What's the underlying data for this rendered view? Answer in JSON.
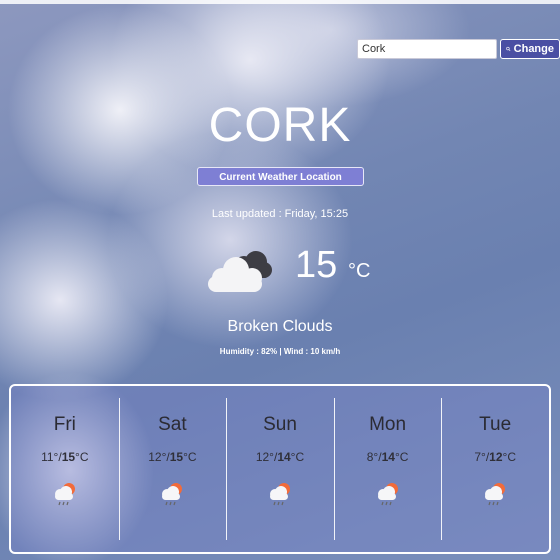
{
  "search": {
    "value": "Cork",
    "button_label": "Change"
  },
  "city": "CORK",
  "location_button": "Current Weather Location",
  "last_updated": "Last updated : Friday, 15:25",
  "current": {
    "temperature": "15",
    "unit": "°C",
    "description": "Broken Clouds",
    "humidity_wind": "Humidity : 82% | Wind : 10 km/h"
  },
  "forecast": [
    {
      "day": "Fri",
      "low": "11°",
      "high": "15",
      "unit": "°C"
    },
    {
      "day": "Sat",
      "low": "12°",
      "high": "15",
      "unit": "°C"
    },
    {
      "day": "Sun",
      "low": "12°",
      "high": "14",
      "unit": "°C"
    },
    {
      "day": "Mon",
      "low": "8°",
      "high": "14",
      "unit": "°C"
    },
    {
      "day": "Tue",
      "low": "7°",
      "high": "12",
      "unit": "°C"
    }
  ],
  "colors": {
    "accent": "#4a4fa3",
    "location_button": "#7e7fd4",
    "sun": "#f26b3a"
  }
}
